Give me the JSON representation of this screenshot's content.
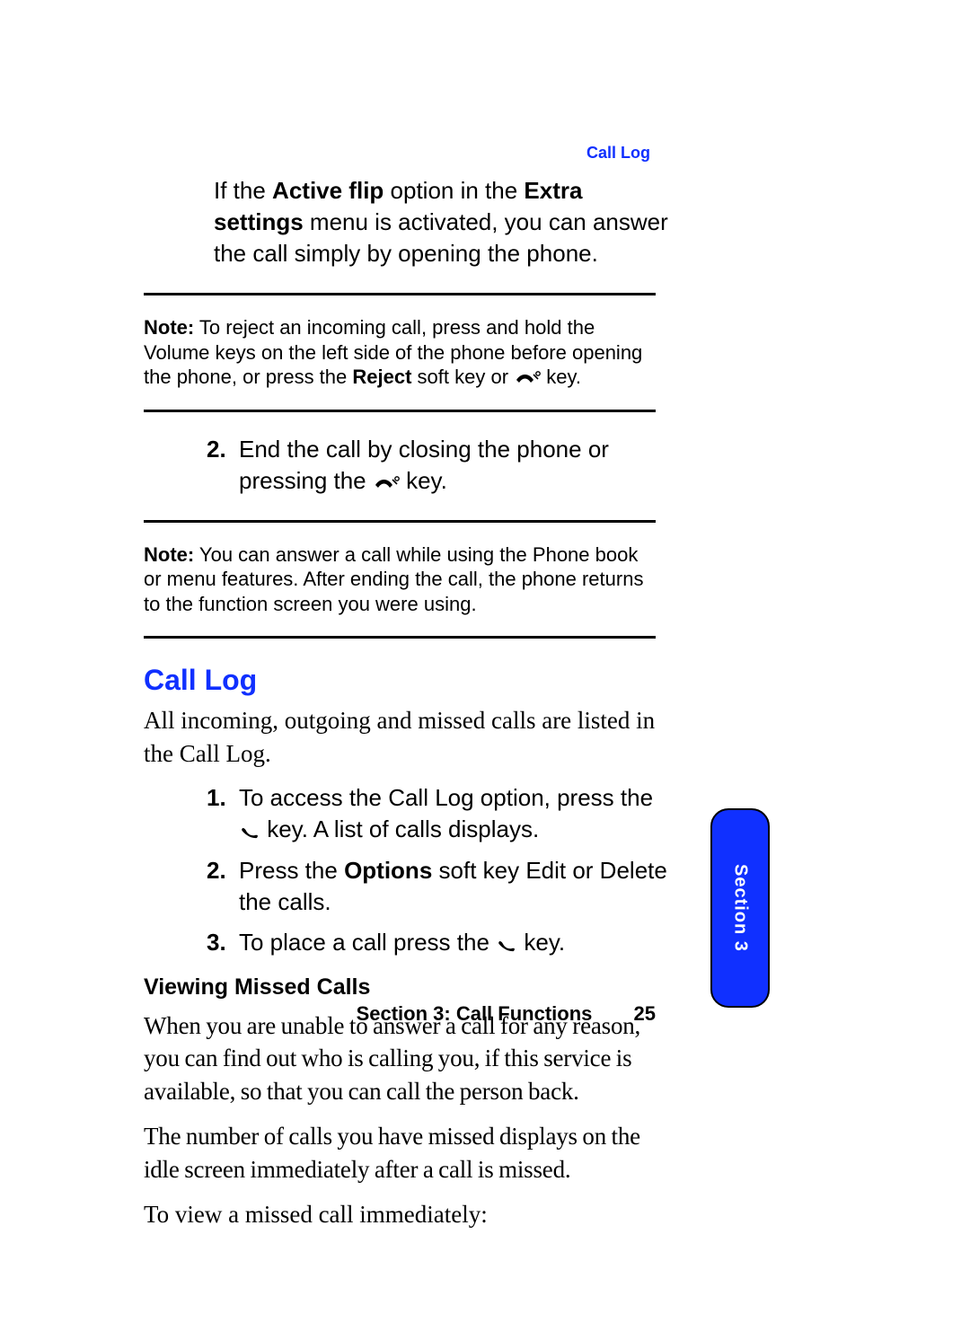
{
  "running_head": "Call Log",
  "intro": {
    "pre": "If the ",
    "b1": "Active flip",
    "mid1": " option in the ",
    "b2": "Extra settings",
    "post": " menu is activated, you can answer the call simply by opening the phone."
  },
  "note1": {
    "label": "Note:",
    "pre": " To reject an incoming call, press and hold the Volume keys on the left side of the phone before opening the phone, or press the ",
    "b1": "Reject",
    "post1": " soft key or ",
    "post2": " key."
  },
  "step2": {
    "num": "2.",
    "pre": "End the call by closing the phone or pressing the ",
    "post": " key."
  },
  "note2": {
    "label": "Note:",
    "text": " You can answer a call while using the Phone book or menu features. After ending the call, the phone returns to the function screen you were using."
  },
  "heading_call_log": "Call Log",
  "call_log_intro": "All incoming, outgoing and missed calls are listed in the Call Log.",
  "cl_steps": {
    "s1": {
      "num": "1.",
      "pre": "To access the Call Log option, press the ",
      "post": " key. A list of calls displays."
    },
    "s2": {
      "num": "2.",
      "pre": "Press the ",
      "b1": "Options",
      "post": " soft key Edit or Delete the calls."
    },
    "s3": {
      "num": "3.",
      "pre": "To place a call press the ",
      "post": " key."
    }
  },
  "heading_missed": "Viewing Missed Calls",
  "missed_p1": "When you are unable to answer a call for any reason, you can find out who is calling you, if this service is available, so that you can call the person back.",
  "missed_p2": "The number of calls you have missed displays on the idle screen immediately after a call is missed.",
  "missed_p3": "To view a missed call immediately:",
  "footer_section": "Section 3: Call Functions",
  "footer_page": "25",
  "tab_label": "Section 3"
}
